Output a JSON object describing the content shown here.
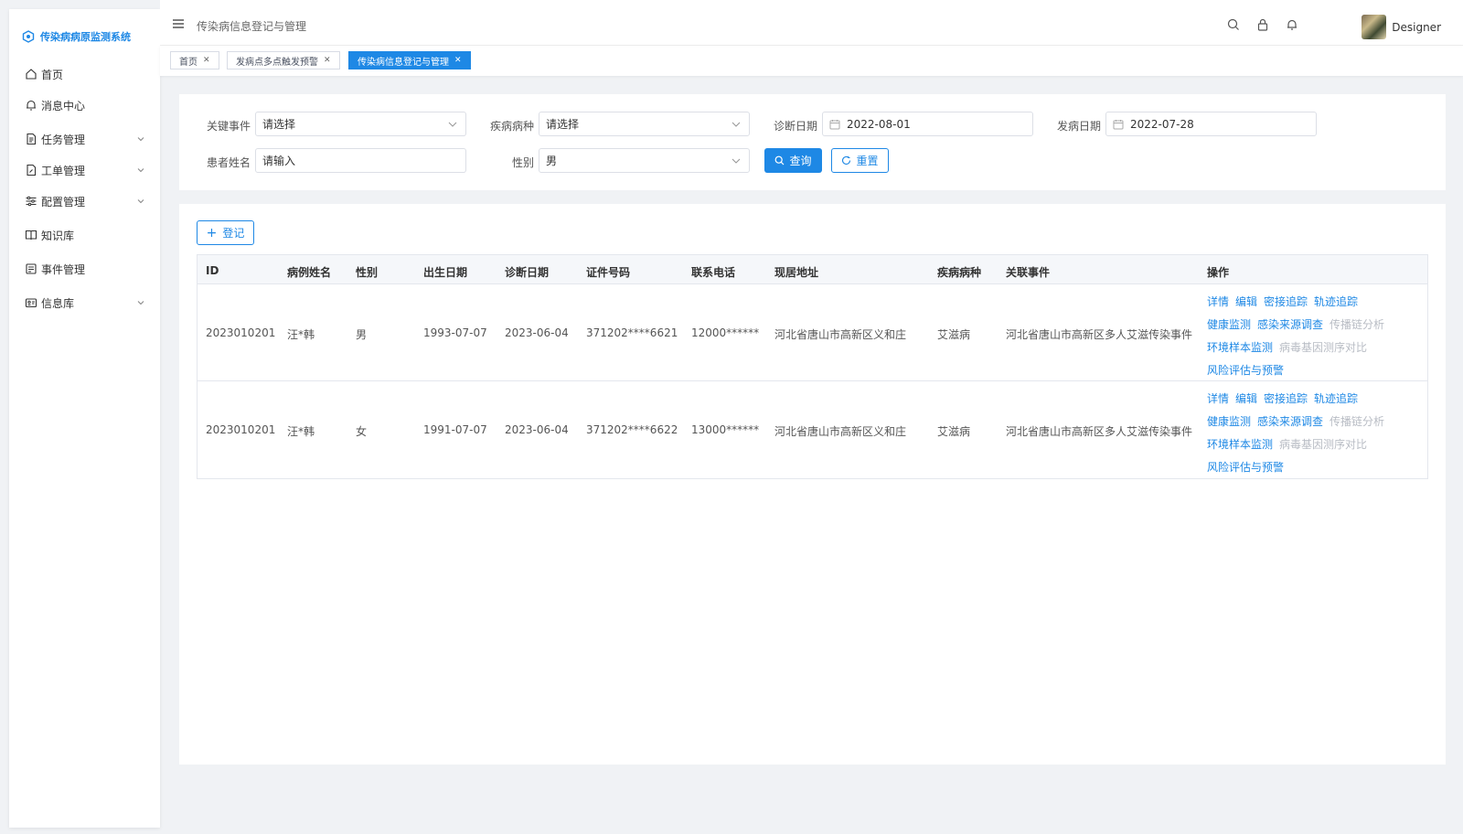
{
  "app": {
    "logo_text": "传染病病原监测系统"
  },
  "sidebar": {
    "items": [
      {
        "label": "首页",
        "icon": "home-icon",
        "expandable": false
      },
      {
        "label": "消息中心",
        "icon": "bell-icon",
        "expandable": false
      },
      {
        "label": "任务管理",
        "icon": "document-icon",
        "expandable": true
      },
      {
        "label": "工单管理",
        "icon": "edit-document-icon",
        "expandable": true
      },
      {
        "label": "配置管理",
        "icon": "sliders-icon",
        "expandable": true
      },
      {
        "label": "知识库",
        "icon": "book-icon",
        "expandable": false
      },
      {
        "label": "事件管理",
        "icon": "calendar-list-icon",
        "expandable": false
      },
      {
        "label": "信息库",
        "icon": "id-card-icon",
        "expandable": true
      }
    ]
  },
  "header": {
    "title": "传染病信息登记与管理",
    "icons": [
      "search-icon",
      "lock-icon",
      "bell-icon"
    ],
    "user_name": "Designer"
  },
  "tabs": [
    {
      "label": "首页",
      "active": false
    },
    {
      "label": "发病点多点触发预警",
      "active": false
    },
    {
      "label": "传染病信息登记与管理",
      "active": true
    }
  ],
  "filters": {
    "key_event_label": "关键事件",
    "key_event_value": "请选择",
    "disease_label": "疾病病种",
    "disease_value": "请选择",
    "diagnosis_date_label": "诊断日期",
    "diagnosis_date_value": "2022-08-01",
    "onset_date_label": "发病日期",
    "onset_date_value": "2022-07-28",
    "patient_name_label": "患者姓名",
    "patient_name_placeholder": "请输入",
    "gender_label": "性别",
    "gender_value": "男",
    "query_label": "查询",
    "reset_label": "重置"
  },
  "toolbar": {
    "add_label": "登记"
  },
  "table": {
    "columns": [
      "ID",
      "病例姓名",
      "性别",
      "出生日期",
      "诊断日期",
      "证件号码",
      "联系电话",
      "现居地址",
      "疾病病种",
      "关联事件",
      "操作"
    ],
    "rows": [
      [
        "2023010201",
        "汪*韩",
        "男",
        "1993-07-07",
        "2023-06-04",
        "371202****6621",
        "12000******",
        "河北省唐山市高新区义和庄",
        "艾滋病",
        "河北省唐山市高新区多人艾滋传染事件"
      ],
      [
        "2023010201",
        "汪*韩",
        "女",
        "1991-07-07",
        "2023-06-04",
        "371202****6622",
        "13000******",
        "河北省唐山市高新区义和庄",
        "艾滋病",
        "河北省唐山市高新区多人艾滋传染事件"
      ]
    ],
    "actions": [
      [
        {
          "label": "详情",
          "enabled": true
        },
        {
          "label": "编辑",
          "enabled": true
        },
        {
          "label": "密接追踪",
          "enabled": true
        },
        {
          "label": "轨迹追踪",
          "enabled": true
        }
      ],
      [
        {
          "label": "健康监测",
          "enabled": true
        },
        {
          "label": "感染来源调查",
          "enabled": true
        },
        {
          "label": "传播链分析",
          "enabled": false
        }
      ],
      [
        {
          "label": "环境样本监测",
          "enabled": true
        },
        {
          "label": "病毒基因测序对比",
          "enabled": false
        }
      ],
      [
        {
          "label": "风险评估与预警",
          "enabled": true
        }
      ]
    ]
  },
  "colors": {
    "primary": "#1e88e5",
    "disabled": "#b8bcc4",
    "background": "#f0f2f5"
  }
}
